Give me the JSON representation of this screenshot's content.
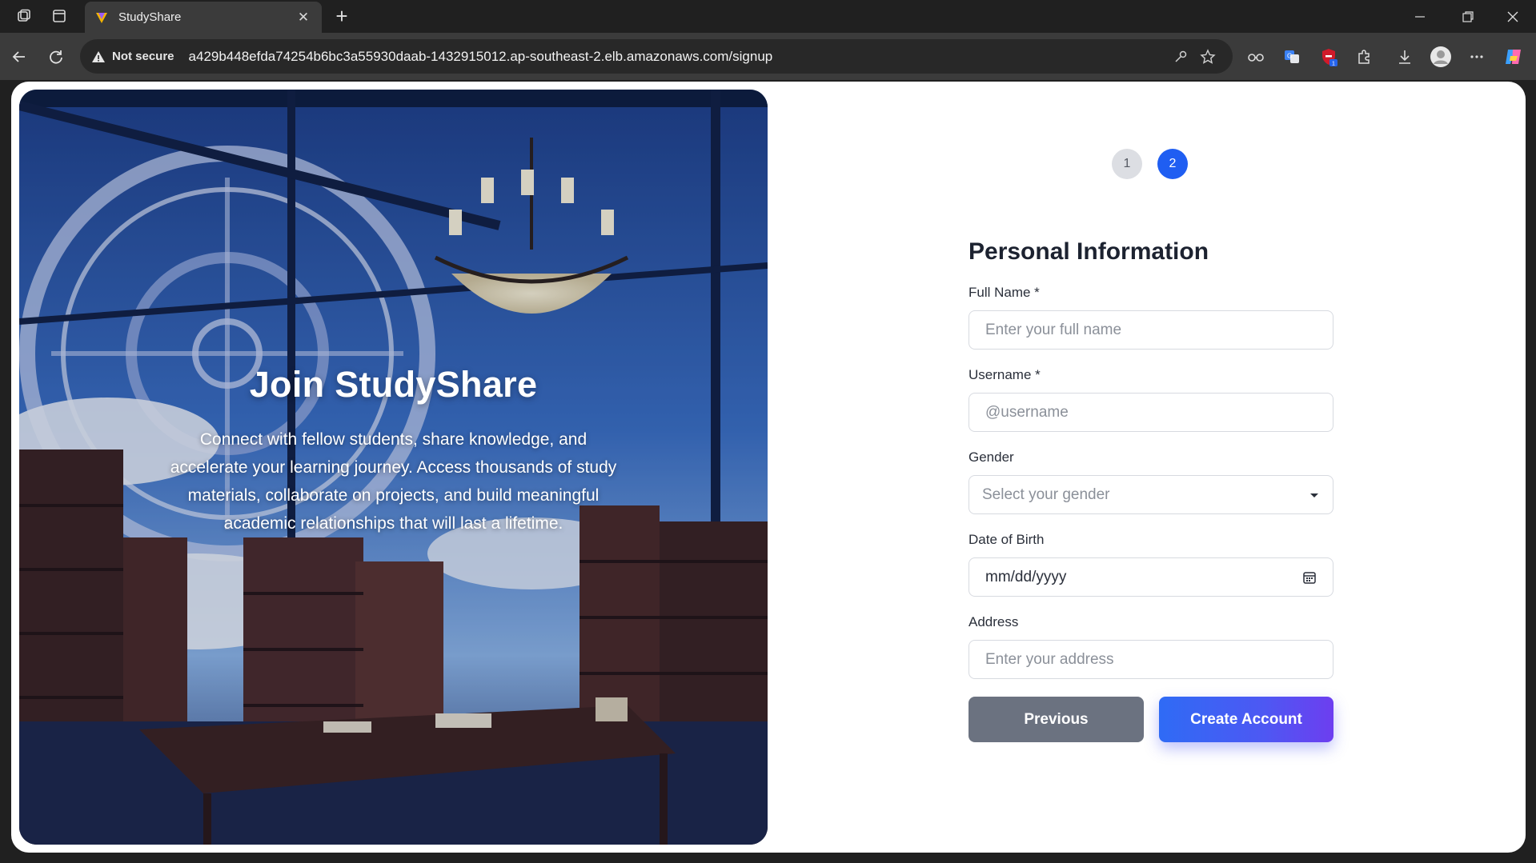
{
  "browser": {
    "tab_title": "StudyShare",
    "tab_close": "✕",
    "new_tab": "+",
    "security_label": "Not secure",
    "url": "a429b448efda74254b6bc3a55930daab-1432915012.ap-southeast-2.elb.amazonaws.com/signup",
    "extension_badge": "1"
  },
  "hero": {
    "title": "Join StudyShare",
    "description": "Connect with fellow students, share knowledge, and accelerate your learning journey. Access thousands of study materials, collaborate on projects, and build meaningful academic relationships that will last a lifetime."
  },
  "steps": [
    {
      "label": "1",
      "state": "inactive"
    },
    {
      "label": "2",
      "state": "active"
    }
  ],
  "form": {
    "title": "Personal Information",
    "full_name": {
      "label": "Full Name *",
      "placeholder": "Enter your full name"
    },
    "username": {
      "label": "Username *",
      "placeholder": "@username"
    },
    "gender": {
      "label": "Gender",
      "selected": "Select your gender"
    },
    "dob": {
      "label": "Date of Birth",
      "value": "mm/dd/yyyy"
    },
    "address": {
      "label": "Address",
      "placeholder": "Enter your address"
    },
    "previous_button": "Previous",
    "create_button": "Create Account"
  },
  "colors": {
    "primary": "#1f5ef2",
    "secondary_button": "#6b7280",
    "heading": "#1c2230"
  }
}
